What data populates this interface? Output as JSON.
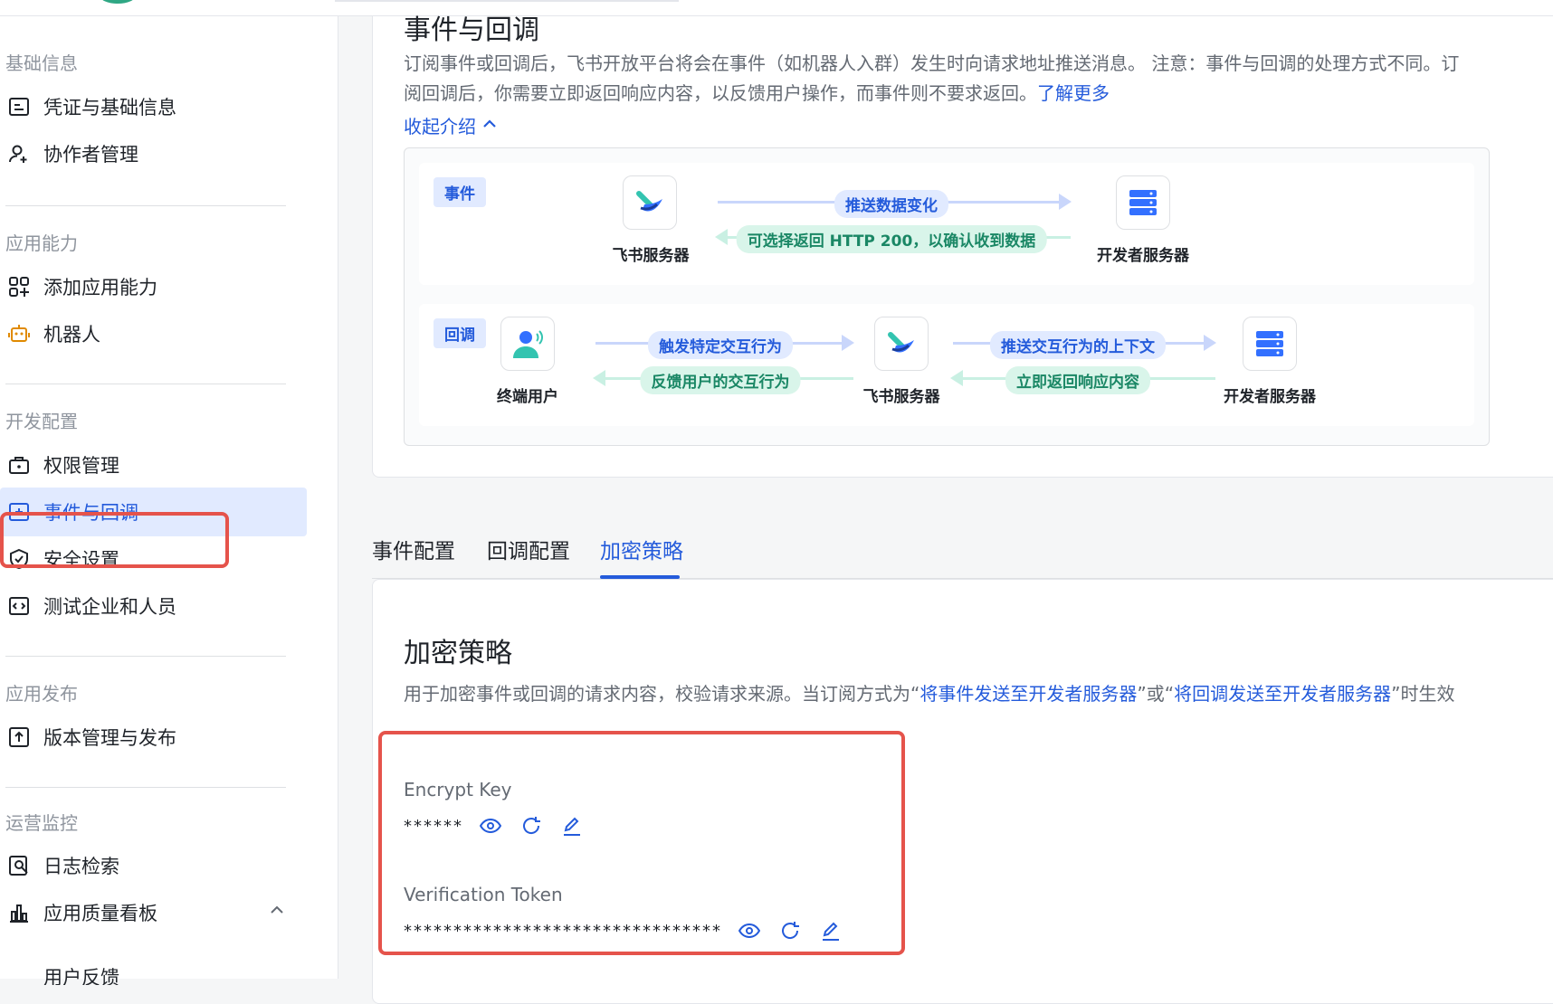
{
  "sidebar": {
    "sections": [
      {
        "label": "基础信息"
      },
      {
        "label": "应用能力"
      },
      {
        "label": "开发配置"
      },
      {
        "label": "应用发布"
      },
      {
        "label": "运营监控"
      }
    ],
    "items": [
      {
        "label": "凭证与基础信息",
        "icon": "document-list-icon"
      },
      {
        "label": "协作者管理",
        "icon": "user-add-icon"
      },
      {
        "label": "添加应用能力",
        "icon": "app-grid-add-icon"
      },
      {
        "label": "机器人",
        "icon": "robot-icon"
      },
      {
        "label": "权限管理",
        "icon": "permission-briefcase-icon"
      },
      {
        "label": "事件与回调",
        "icon": "event-plus-icon"
      },
      {
        "label": "安全设置",
        "icon": "shield-check-icon"
      },
      {
        "label": "测试企业和人员",
        "icon": "code-box-icon"
      },
      {
        "label": "版本管理与发布",
        "icon": "upload-box-icon"
      },
      {
        "label": "日志检索",
        "icon": "log-search-icon"
      },
      {
        "label": "应用质量看板",
        "icon": "bar-chart-icon"
      },
      {
        "label": "用户反馈",
        "icon": "feedback-icon"
      }
    ]
  },
  "intro": {
    "title": "事件与回调",
    "desc_main": "订阅事件或回调后，飞书开放平台将会在事件（如机器人入群）发生时向请求地址推送消息。 注意：事件与回调的处理方式不同。订阅回调后，你需要立即返回响应内容，以反馈用户操作，而事件则不要求返回。",
    "learn_more": "了解更多",
    "collapse": "收起介绍"
  },
  "flow": {
    "event": {
      "tag": "事件",
      "from": "飞书服务器",
      "to": "开发者服务器",
      "push": "推送数据变化",
      "reply": "可选择返回 HTTP 200，以确认收到数据"
    },
    "callback": {
      "tag": "回调",
      "user": "终端用户",
      "middle": "飞书服务器",
      "to": "开发者服务器",
      "trigger": "触发特定交互行为",
      "feedback": "反馈用户的交互行为",
      "push_ctx": "推送交互行为的上下文",
      "reply_now": "立即返回响应内容"
    }
  },
  "tabs": [
    {
      "label": "事件配置"
    },
    {
      "label": "回调配置"
    },
    {
      "label": "加密策略"
    }
  ],
  "active_tab": "加密策略",
  "encryption": {
    "title": "加密策略",
    "desc_prefix": "用于加密事件或回调的请求内容，校验请求来源。当订阅方式为“",
    "link1": "将事件发送至开发者服务器",
    "desc_mid": "”或“",
    "link2": "将回调发送至开发者服务器",
    "desc_suffix": "”时生效",
    "encrypt_key_label": "Encrypt Key",
    "encrypt_key_value": "******",
    "token_label": "Verification Token",
    "token_value": "********************************"
  },
  "colors": {
    "accent": "#245bdb",
    "highlight_border": "#e5534b",
    "active_bg": "#e1eaff"
  }
}
